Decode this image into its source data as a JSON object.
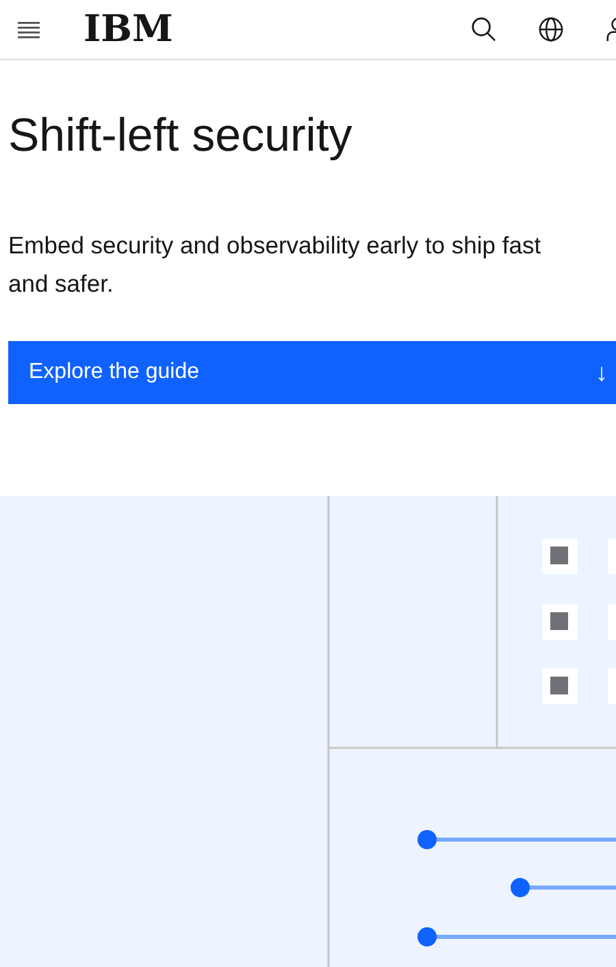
{
  "header": {
    "logo": "IBM"
  },
  "hero": {
    "title": "Shift-left security",
    "description_lines": [
      "Embed security and observability early to ship fast",
      "and safer."
    ],
    "button": {
      "label": "Explore the guide",
      "arrow": "↓"
    }
  }
}
